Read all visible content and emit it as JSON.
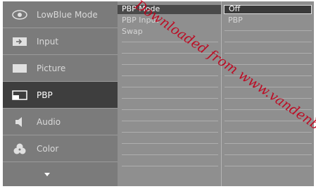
{
  "main_menu": {
    "items": [
      {
        "label": "LowBlue Mode",
        "icon": "eye-icon"
      },
      {
        "label": "Input",
        "icon": "input-source-icon"
      },
      {
        "label": "Picture",
        "icon": "picture-icon"
      },
      {
        "label": "PBP",
        "icon": "pbp-icon",
        "selected": true
      },
      {
        "label": "Audio",
        "icon": "speaker-icon"
      },
      {
        "label": "Color",
        "icon": "color-palette-icon"
      }
    ],
    "more_icon": "chevron-down-icon"
  },
  "submenu": {
    "items": [
      "PBP Mode",
      "PBP Input",
      "Swap"
    ],
    "selected": "PBP Mode"
  },
  "options": {
    "items": [
      "Off",
      "PBP"
    ],
    "selected": "Off"
  },
  "watermark": "Downloaded from www.vandenborre.be",
  "colors": {
    "background": "#8a8a8a",
    "selected_main": "#3e3e3e",
    "watermark": "#c0001a"
  }
}
